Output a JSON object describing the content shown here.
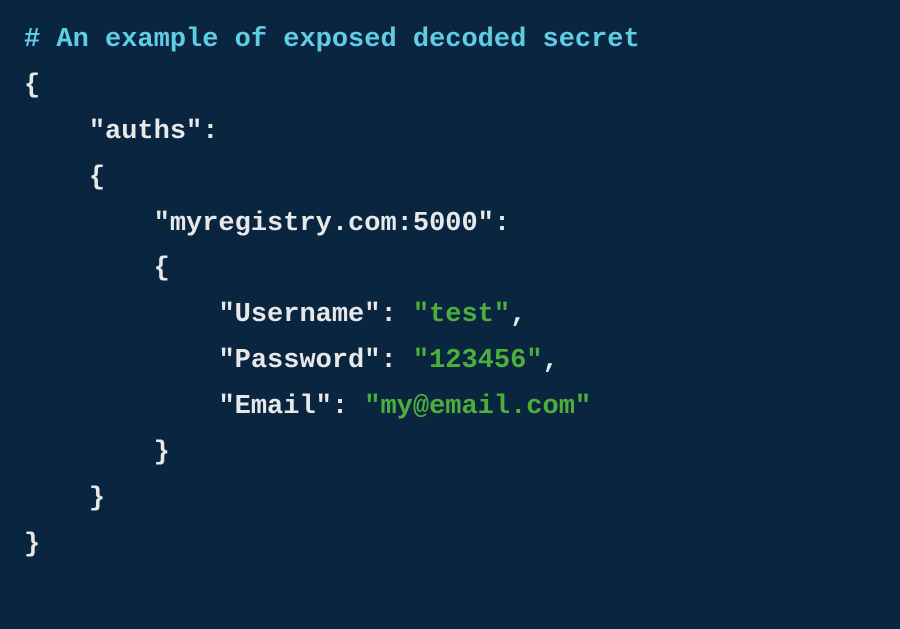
{
  "code": {
    "comment_symbol": "#",
    "comment_text": "An example of exposed decoded secret",
    "brace_open": "{",
    "brace_close": "}",
    "colon": ":",
    "comma": ",",
    "keys": {
      "auths": "\"auths\"",
      "registry": "\"myregistry.com:5000\"",
      "username": "\"Username\"",
      "password": "\"Password\"",
      "email": "\"Email\""
    },
    "vals": {
      "username": "\"test\"",
      "password": "\"123456\"",
      "email": "\"my@email.com\""
    }
  }
}
